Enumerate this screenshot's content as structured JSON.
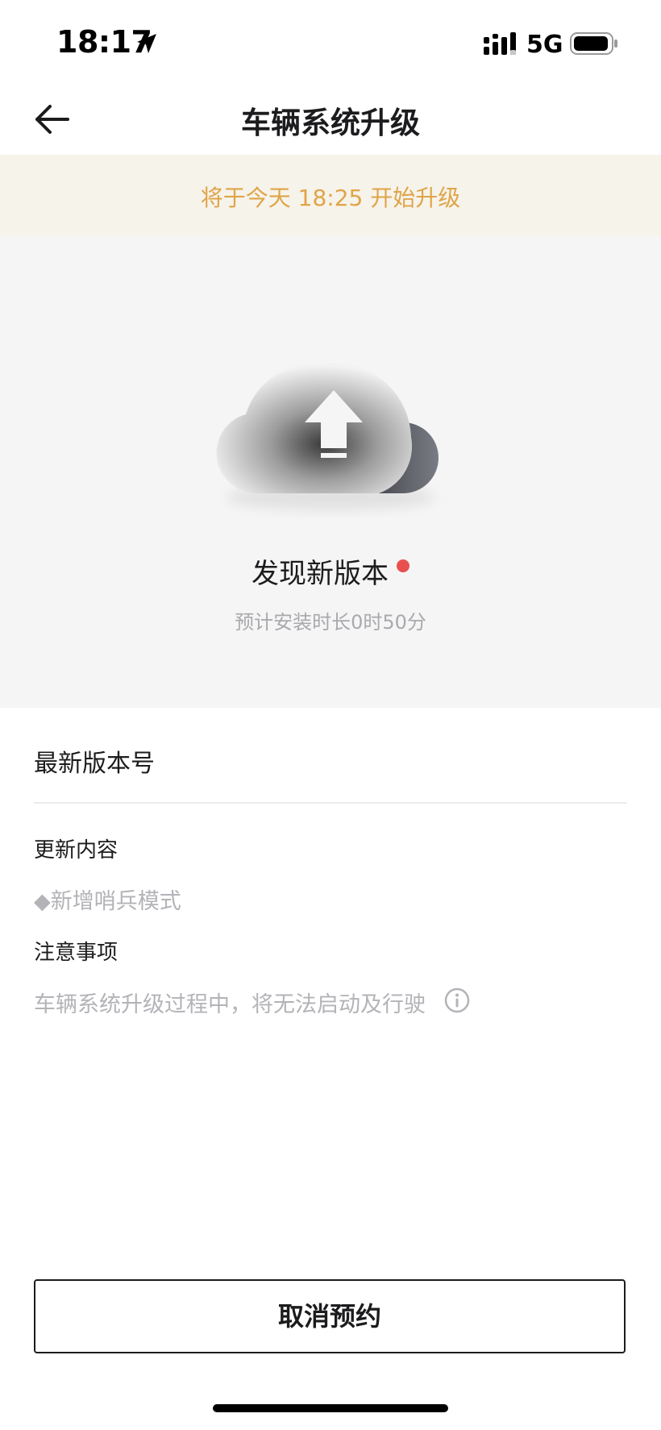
{
  "status_bar": {
    "time": "18:17",
    "network": "5G",
    "icons": [
      "location-arrow-icon",
      "signal-bars-icon",
      "battery-icon"
    ]
  },
  "nav": {
    "title": "车辆系统升级",
    "back_icon": "arrow-left-icon"
  },
  "banner": {
    "text": "将于今天 18:25 开始升级"
  },
  "hero": {
    "icon": "cloud-upload-icon",
    "title": "发现新版本",
    "install_time": "预计安装时长0时50分"
  },
  "details": {
    "latest_version_label": "最新版本号",
    "update_content_heading": "更新内容",
    "update_content_item": "◆新增哨兵模式",
    "notes_heading": "注意事项",
    "notes_text": "车辆系统升级过程中，将无法启动及行驶",
    "notes_icon": "info-icon"
  },
  "actions": {
    "cancel_label": "取消预约"
  },
  "colors": {
    "banner_bg": "#f6f3ea",
    "banner_text": "#e0a449",
    "hero_bg": "#f5f5f5",
    "new_dot": "#e85050",
    "muted_text": "#b3b3b8"
  }
}
